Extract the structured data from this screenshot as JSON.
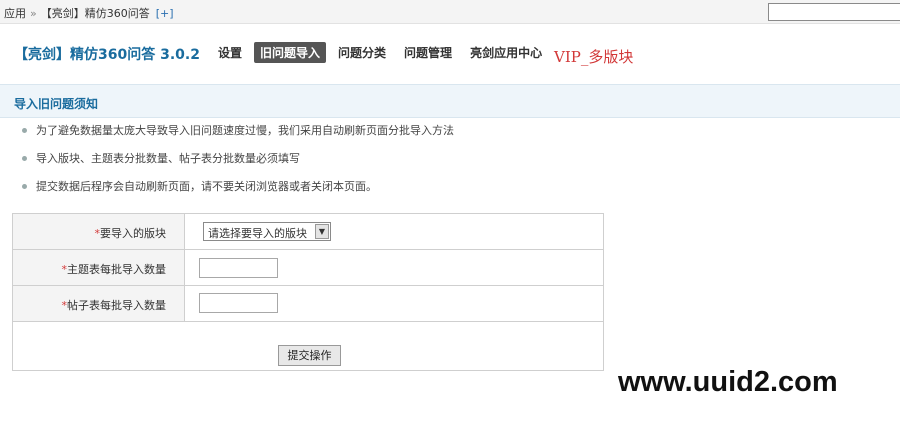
{
  "breadcrumb": {
    "root": "应用",
    "separator": "»",
    "current": "【亮剑】精仿360问答",
    "add_label": "[+]"
  },
  "header": {
    "app_title": "【亮剑】精仿360问答 3.0.2",
    "nav": [
      {
        "label": "设置",
        "active": false
      },
      {
        "label": "旧问题导入",
        "active": true
      },
      {
        "label": "问题分类",
        "active": false
      },
      {
        "label": "问题管理",
        "active": false
      },
      {
        "label": "亮剑应用中心",
        "active": false
      }
    ],
    "vip_label": "VIP_多版块"
  },
  "section": {
    "title": "导入旧问题须知"
  },
  "notes": [
    "为了避免数据量太庞大导致导入旧问题速度过慢，我们采用自动刷新页面分批导入方法",
    "导入版块、主题表分批数量、帖子表分批数量必须填写",
    "提交数据后程序会自动刷新页面，请不要关闭浏览器或者关闭本页面。"
  ],
  "form": {
    "required_mark": "*",
    "forum_label": "要导入的版块",
    "forum_select_value": "请选择要导入的版块",
    "thread_batch_label": "主题表每批导入数量",
    "thread_batch_value": "",
    "post_batch_label": "帖子表每批导入数量",
    "post_batch_value": "",
    "submit_label": "提交操作"
  },
  "watermark": "www.uuid2.com"
}
